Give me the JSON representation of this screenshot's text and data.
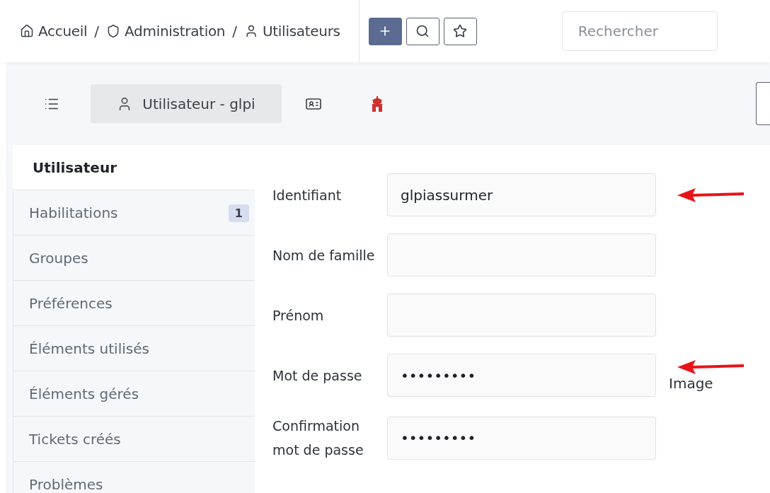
{
  "breadcrumb": [
    {
      "label": "Accueil",
      "kind": "home"
    },
    {
      "label": "Administration",
      "kind": "shield"
    },
    {
      "label": "Utilisateurs",
      "kind": "user"
    }
  ],
  "breadcrumb_separator": "/",
  "toolbar": [
    {
      "kind": "add",
      "primary": true
    },
    {
      "kind": "search",
      "primary": false
    },
    {
      "kind": "star",
      "primary": false
    }
  ],
  "search": {
    "placeholder": "Rechercher"
  },
  "tabs": [
    {
      "kind": "list",
      "selected": false
    },
    {
      "kind": "user",
      "label": "Utilisateur - glpi",
      "selected": true
    },
    {
      "kind": "card",
      "selected": false
    },
    {
      "kind": "tower",
      "selected": false
    }
  ],
  "sidebar": {
    "items": [
      {
        "label": "Utilisateur",
        "selected": true
      },
      {
        "label": "Habilitations",
        "selected": false,
        "badge": "1"
      },
      {
        "label": "Groupes",
        "selected": false
      },
      {
        "label": "Préférences",
        "selected": false
      },
      {
        "label": "Éléments utilisés",
        "selected": false
      },
      {
        "label": "Éléments gérés",
        "selected": false
      },
      {
        "label": "Tickets créés",
        "selected": false
      },
      {
        "label": "Problèmes",
        "selected": false
      }
    ]
  },
  "form": {
    "fields": [
      {
        "label": "Identifiant",
        "value": "glpiassurmer",
        "arrow": true
      },
      {
        "label": "Nom de famille",
        "arrow": false
      },
      {
        "label": "Prénom",
        "arrow": false
      },
      {
        "label": "Mot de passe",
        "value": "•••••••••",
        "arrow": true,
        "image_alt": "Image"
      },
      {
        "label": "Confirmation mot de passe",
        "value": "•••••••••",
        "arrow": false
      }
    ]
  }
}
